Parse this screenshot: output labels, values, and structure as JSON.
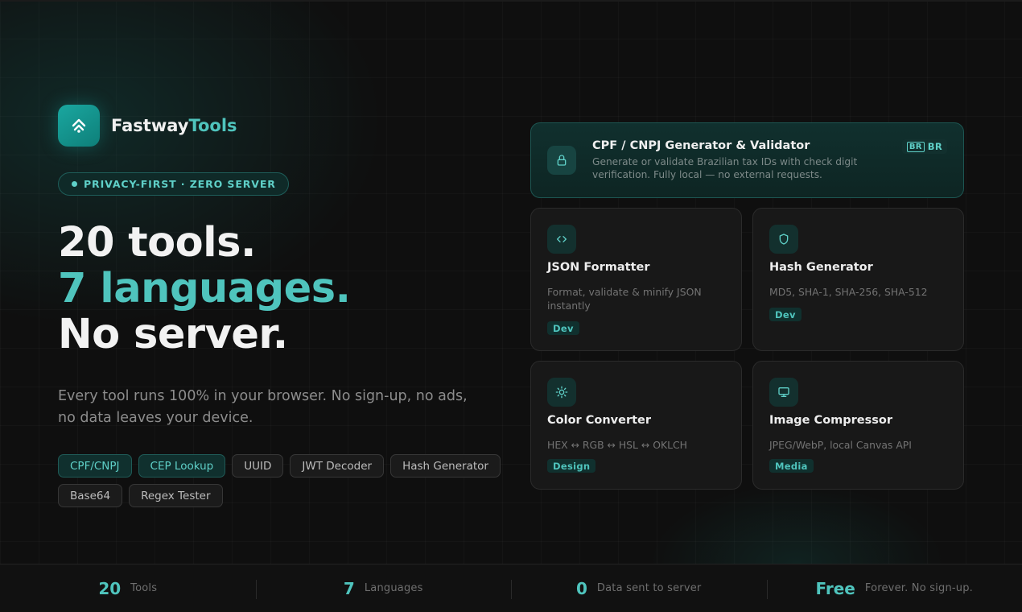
{
  "brand": {
    "name_part1": "Fastway",
    "name_part2": "Tools",
    "accent": "#4fc4bd"
  },
  "badge": {
    "label": "PRIVACY-FIRST · ZERO SERVER"
  },
  "hero": {
    "line1": "20 tools.",
    "line2": "7 languages.",
    "line3": "No server."
  },
  "subtitle": "Every tool runs 100% in your browser. No sign-up, no ads, no data leaves your device.",
  "chips": [
    {
      "label": "CPF/CNPJ",
      "style": "teal"
    },
    {
      "label": "CEP Lookup",
      "style": "teal"
    },
    {
      "label": "UUID",
      "style": "gray"
    },
    {
      "label": "JWT Decoder",
      "style": "gray"
    },
    {
      "label": "Hash Generator",
      "style": "gray"
    },
    {
      "label": "Base64",
      "style": "gray"
    },
    {
      "label": "Regex Tester",
      "style": "gray"
    }
  ],
  "featured": {
    "icon": "lock-icon",
    "title": "CPF / CNPJ Generator & Validator",
    "description": "Generate or validate Brazilian tax IDs with check digit verification. Fully local — no external requests.",
    "flag_glyph": "BR",
    "flag_label": "BR"
  },
  "tools": [
    {
      "icon": "code-icon",
      "title": "JSON Formatter",
      "description": "Format, validate & minify JSON instantly",
      "tag": "Dev"
    },
    {
      "icon": "shield-icon",
      "title": "Hash Generator",
      "description": "MD5, SHA-1, SHA-256, SHA-512",
      "tag": "Dev"
    },
    {
      "icon": "sun-icon",
      "title": "Color Converter",
      "description": "HEX ↔ RGB ↔ HSL ↔ OKLCH",
      "tag": "Design"
    },
    {
      "icon": "monitor-icon",
      "title": "Image Compressor",
      "description": "JPEG/WebP, local Canvas API",
      "tag": "Media"
    }
  ],
  "stats": [
    {
      "value": "20",
      "label": "Tools"
    },
    {
      "value": "7",
      "label": "Languages"
    },
    {
      "value": "0",
      "label": "Data sent to server"
    },
    {
      "value": "Free",
      "label": "Forever. No sign-up."
    }
  ]
}
